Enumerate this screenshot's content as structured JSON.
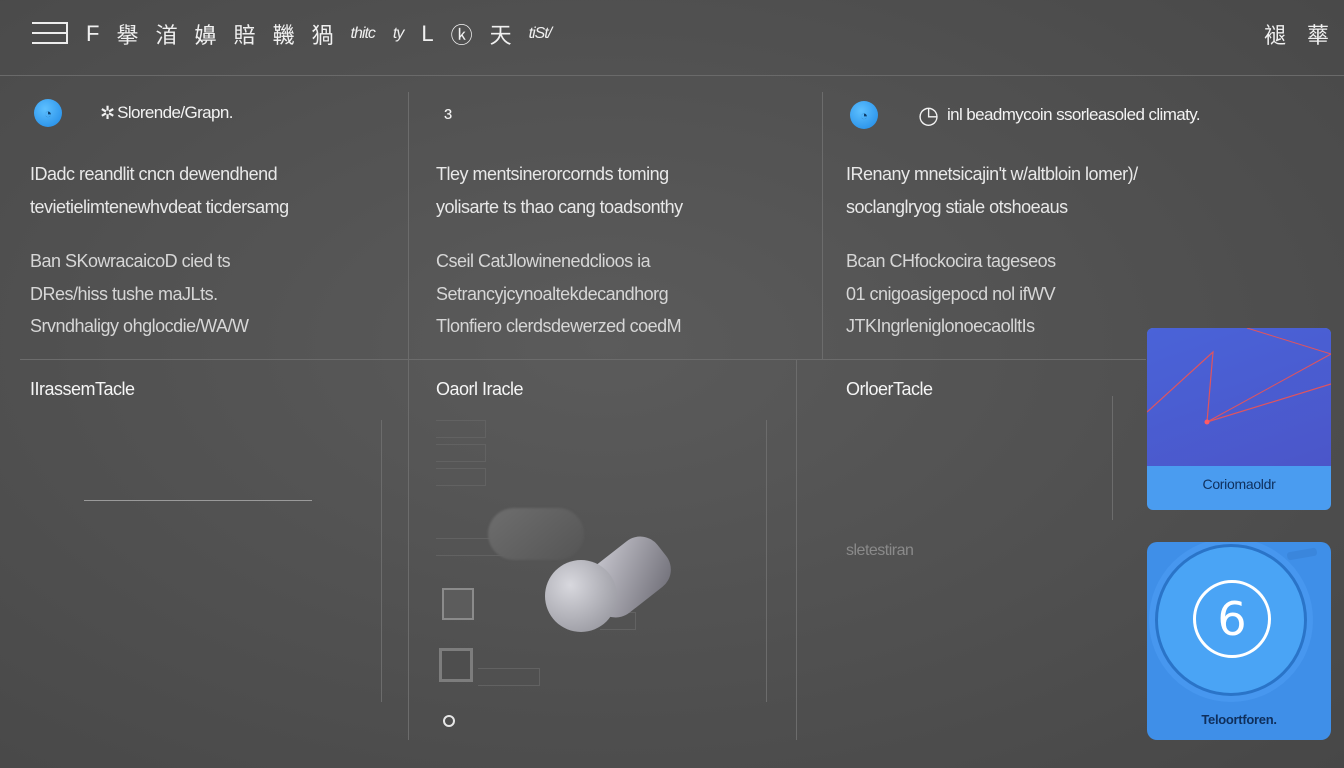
{
  "toolbar": {
    "items": [
      "F",
      "擧",
      "渞",
      "嬶",
      "賠",
      "鞿",
      "猧",
      "thitc",
      "ty",
      "L",
      "ⓚ",
      "天",
      "tiSt/"
    ],
    "right_items": [
      "褪",
      "蕐"
    ]
  },
  "columns": [
    {
      "title": "Slorende/Grapn.",
      "lines": [
        "IDadc reandlit cncn dewendhend",
        "tevietielimtenewhvdeat ticdersamg"
      ],
      "lines_b": [
        "Ban SKowracaicoD cied ts",
        "DRes/hiss tushe maJLts.",
        "Srvndhaligy ohglocdie/WA/W"
      ],
      "section": "IIrassemTacle"
    },
    {
      "title": "ɜ",
      "lines": [
        "Tley mentsinerorcornds toming",
        "yolisarte ts thao cang toadsonthy"
      ],
      "lines_b": [
        "Cseil CatJlowinenedclioos ia",
        "Setrancyjcynoaltekdecandhorg",
        "Tlonfiero clerdsdewerzed coedM"
      ],
      "section": "Oaorl Iracle"
    },
    {
      "title": "inl beadmycoin ssorleasoled climaty.",
      "lines": [
        "IRenany mnetsicajin't w/altbloin lomer)/",
        "soclanglryog stiale otshoeaus"
      ],
      "lines_b": [
        "Bcan CHfockocira tageseos",
        "01 cnigoasigepocd nol ifWV",
        "JTKIngrleniglonoecaolltIs"
      ],
      "section": "OrloerTacle",
      "ghost": "sletestiran"
    }
  ],
  "widgets": {
    "graph_card_label": "Coriomaoldr",
    "dial_card_label": "Teloortforen.",
    "dial_glyph": "6"
  },
  "colors": {
    "accent": "#3f8fe8",
    "graph_bg": "#4a5ed2",
    "graph_line": "#e0545e"
  }
}
